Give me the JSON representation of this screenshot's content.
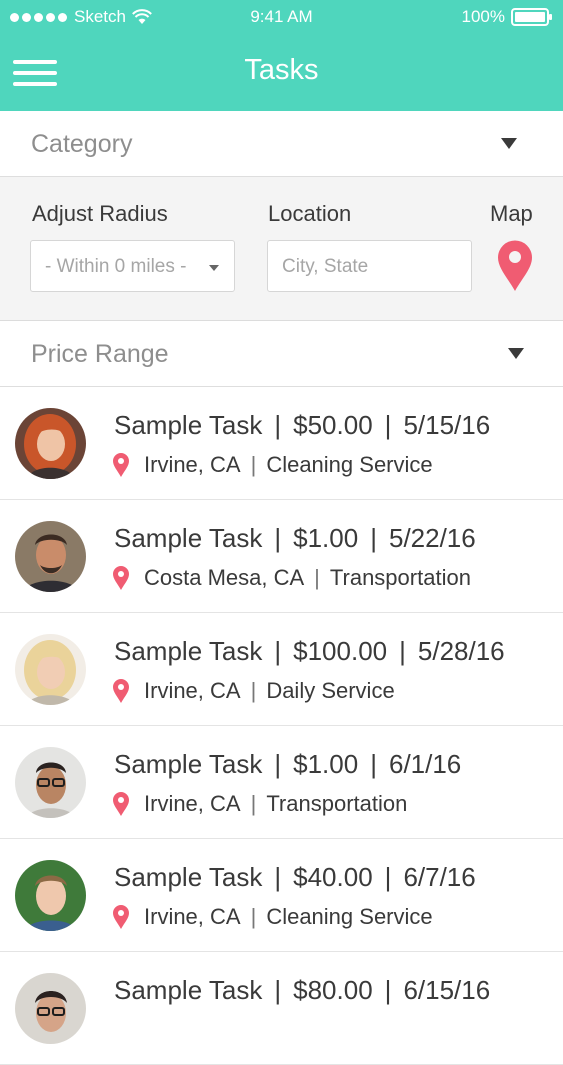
{
  "status_bar": {
    "carrier": "Sketch",
    "time": "9:41 AM",
    "battery": "100%"
  },
  "header": {
    "title": "Tasks"
  },
  "filters": {
    "category_label": "Category",
    "radius_label": "Adjust Radius",
    "radius_value": "- Within 0 miles -",
    "location_label": "Location",
    "location_placeholder": "City, State",
    "map_label": "Map",
    "price_label": "Price Range"
  },
  "separator": "|",
  "colors": {
    "accent": "#4fd6bd",
    "pin": "#f05c72"
  },
  "tasks": [
    {
      "title": "Sample Task",
      "price": "$50.00",
      "date": "5/15/16",
      "location": "Irvine, CA",
      "category": "Cleaning Service"
    },
    {
      "title": "Sample Task",
      "price": "$1.00",
      "date": "5/22/16",
      "location": "Costa Mesa, CA",
      "category": "Transportation"
    },
    {
      "title": "Sample Task",
      "price": "$100.00",
      "date": "5/28/16",
      "location": "Irvine, CA",
      "category": "Daily Service"
    },
    {
      "title": "Sample Task",
      "price": "$1.00",
      "date": "6/1/16",
      "location": "Irvine, CA",
      "category": "Transportation"
    },
    {
      "title": "Sample Task",
      "price": "$40.00",
      "date": "6/7/16",
      "location": "Irvine, CA",
      "category": "Cleaning Service"
    },
    {
      "title": "Sample Task",
      "price": "$80.00",
      "date": "6/15/16",
      "location": "",
      "category": ""
    }
  ]
}
